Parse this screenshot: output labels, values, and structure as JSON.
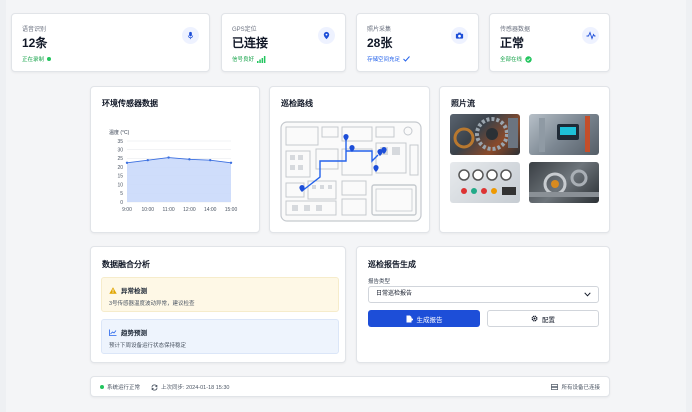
{
  "stats": [
    {
      "label": "语音识别",
      "value": "12条",
      "sub": "正在录制",
      "icon": "microphone-icon",
      "sub_color": "#16a34a"
    },
    {
      "label": "GPS定位",
      "value": "已连接",
      "sub": "信号良好",
      "icon": "location-pin-icon",
      "sub_color": "#16a34a"
    },
    {
      "label": "照片采集",
      "value": "28张",
      "sub": "存储空间充足",
      "icon": "camera-icon",
      "sub_color": "#2563eb"
    },
    {
      "label": "传感器数据",
      "value": "正常",
      "sub": "全部在线",
      "icon": "waveform-icon",
      "sub_color": "#16a34a"
    }
  ],
  "env_panel": {
    "title": "环境传感器数据",
    "chart_data": {
      "type": "area",
      "ylabel": "温度 (°C)",
      "x": [
        "9:00",
        "10:00",
        "11:00",
        "12:00",
        "14:00",
        "15:00"
      ],
      "y_ticks": [
        "0",
        "5",
        "10",
        "15",
        "20",
        "25",
        "30",
        "35"
      ],
      "ylim": [
        0,
        35
      ],
      "series": [
        {
          "values": [
            22.5,
            24,
            25.5,
            24.5,
            24,
            22.5
          ]
        }
      ],
      "grid": true,
      "fill_color": "#c7d7fa",
      "line_color": "#3b6fe0"
    }
  },
  "route_panel": {
    "title": "巡检路线"
  },
  "photo_panel": {
    "title": "照片流",
    "photos": [
      "gear-machinery-photo",
      "industrial-gauge-photo",
      "control-panel-photo",
      "pipe-valve-photo"
    ]
  },
  "fusion_panel": {
    "title": "数据融合分析",
    "anomaly": {
      "title": "异常检测",
      "desc": "3号传感器温度波动异常，建议检查"
    },
    "trend": {
      "title": "趋势预测",
      "desc": "预计下周设备运行状态保持稳定"
    }
  },
  "report_panel": {
    "title": "巡检报告生成",
    "field_label": "报告类型",
    "selected_type": "日常巡检报告",
    "generate_label": "生成报告",
    "config_label": "配置"
  },
  "footer": {
    "status": "系统运行正常",
    "last_sync": "上次同步: 2024-01-18 15:30",
    "devices": "所有设备已连接"
  },
  "colors": {
    "primary": "#1d4ed8",
    "success": "#22c55e",
    "warning": "#d97706"
  }
}
